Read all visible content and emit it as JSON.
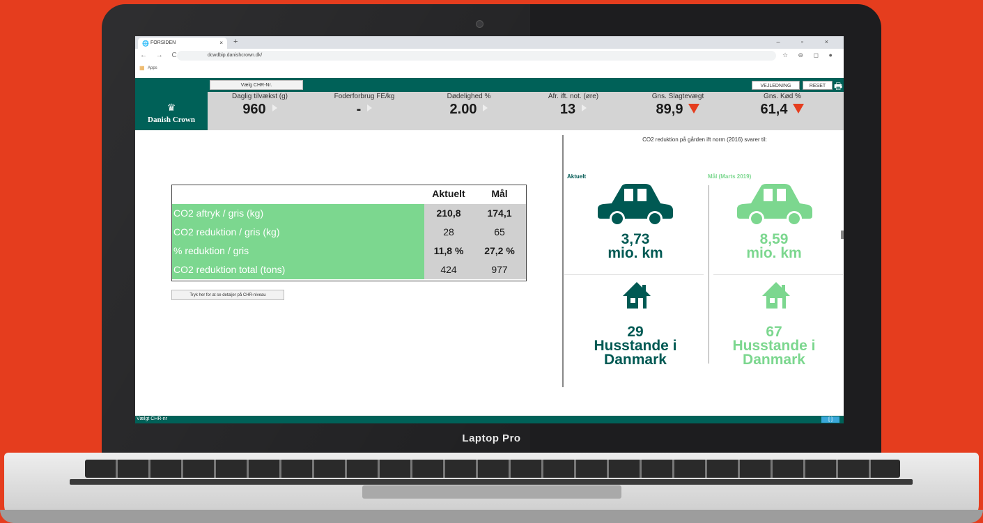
{
  "laptop": {
    "model": "Laptop Pro"
  },
  "browser": {
    "tab_title": "FORSIDEN",
    "tab_close": "×",
    "new_tab": "+",
    "window_controls": "– ▫ ×",
    "nav_icons": "← → C",
    "url": "dcwdbip.danishcrown.dk/",
    "toolbar_icons": "☆ ⊖ ◻ ●",
    "bookmarks_apps": "Apps"
  },
  "header": {
    "select_chr": "Vælg CHR-Nr.",
    "brand_crown": "♛",
    "brand": "Danish Crown",
    "vejledning": "VEJLEDNING",
    "reset": "RESET",
    "print_icon": "🖶"
  },
  "kpis": [
    {
      "label": "Daglig tilvækst (g)",
      "value": "960",
      "trend": "neutral"
    },
    {
      "label": "Foderforbrug FE/kg",
      "value": "-",
      "trend": "neutral"
    },
    {
      "label": "Dødelighed %",
      "value": "2.00",
      "trend": "neutral"
    },
    {
      "label": "Afr. ift. not. (øre)",
      "value": "13",
      "trend": "neutral"
    },
    {
      "label": "Gns. Slagtevægt",
      "value": "89,9",
      "trend": "down"
    },
    {
      "label": "Gns. Kød %",
      "value": "61,4",
      "trend": "down"
    }
  ],
  "table": {
    "col_aktuelt": "Aktuelt",
    "col_maal": "Mål",
    "rows": [
      {
        "label": "CO2 aftryk / gris (kg)",
        "aktuelt": "210,8",
        "maal": "174,1"
      },
      {
        "label": "CO2 reduktion / gris (kg)",
        "aktuelt": "28",
        "maal": "65"
      },
      {
        "label": "% reduktion / gris",
        "aktuelt": "11,8 %",
        "maal": "27,2 %"
      },
      {
        "label": "CO2 reduktion total (tons)",
        "aktuelt": "424",
        "maal": "977"
      }
    ]
  },
  "detail_button": "Tryk her for at se detaljer på CHR-niveau",
  "co2": {
    "title": "CO2 reduktion på gården ift norm (2016) svarer til:",
    "aktuelt_label": "Aktuelt",
    "maal_label": "Mål (Marts 2019)",
    "aktuelt_km": "3,73",
    "maal_km": "8,59",
    "km_unit": "mio. km",
    "aktuelt_houses": "29",
    "maal_houses": "67",
    "houses_line1": "Husstande i",
    "houses_line2": "Danmark"
  },
  "footer": {
    "label": "Vælgt CHR-nr",
    "button": "[ ]"
  },
  "colors": {
    "accent": "#006158",
    "green": "#7cd78f",
    "down_arrow": "#e53d1e",
    "background": "#e53d1e"
  }
}
